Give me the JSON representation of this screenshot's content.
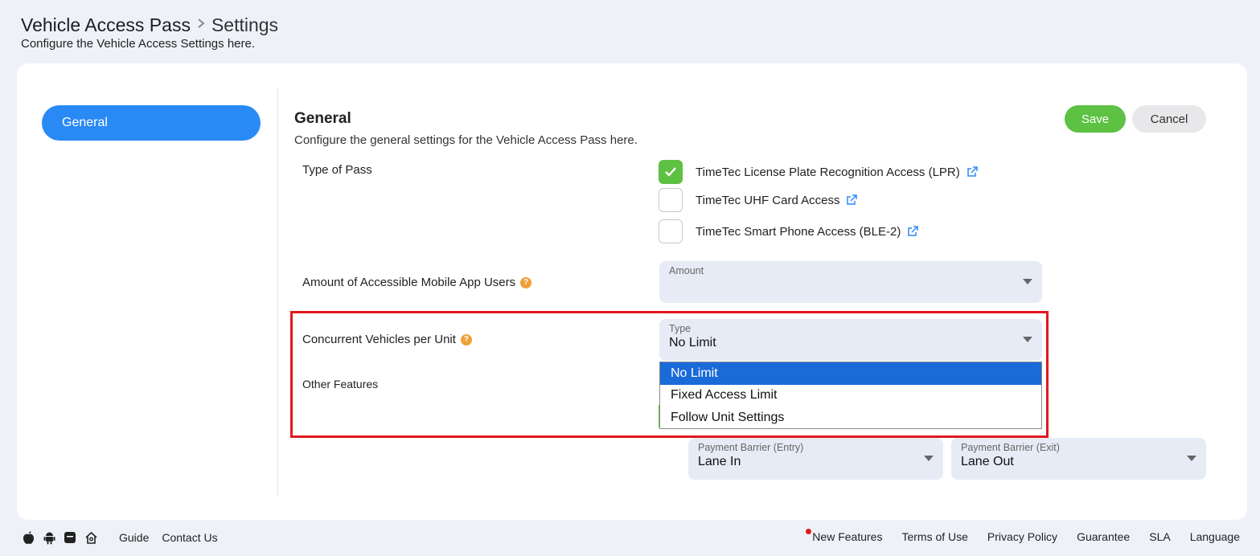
{
  "header": {
    "crumb_root": "Vehicle Access Pass",
    "crumb_current": "Settings",
    "subtitle": "Configure the Vehicle Access Settings here."
  },
  "sidebar": {
    "items": [
      {
        "label": "General",
        "active": true
      }
    ]
  },
  "section": {
    "title": "General",
    "description": "Configure the general settings for the Vehicle Access Pass here.",
    "save_label": "Save",
    "cancel_label": "Cancel"
  },
  "type_of_pass": {
    "label": "Type of Pass",
    "options": [
      {
        "label": "TimeTec License Plate Recognition Access (LPR)",
        "checked": true
      },
      {
        "label": "TimeTec UHF Card Access",
        "checked": false
      },
      {
        "label": "TimeTec Smart Phone Access (BLE-2)",
        "checked": false
      }
    ]
  },
  "mobile_users": {
    "label": "Amount of Accessible Mobile App Users",
    "field_label": "Amount",
    "value": ""
  },
  "concurrent": {
    "label": "Concurrent Vehicles per Unit",
    "field_label": "Type",
    "value": "No Limit",
    "options": [
      "No Limit",
      "Fixed Access Limit",
      "Follow Unit Settings"
    ],
    "selected_index": 0
  },
  "other_features": {
    "label": "Other Features"
  },
  "payment_barrier": {
    "entry_label": "Payment Barrier (Entry)",
    "entry_value": "Lane In",
    "exit_label": "Payment Barrier (Exit)",
    "exit_value": "Lane Out"
  },
  "footer": {
    "left_links": [
      "Guide",
      "Contact Us"
    ],
    "right_links": [
      "New Features",
      "Terms of Use",
      "Privacy Policy",
      "Guarantee",
      "SLA",
      "Language"
    ]
  },
  "colors": {
    "accent": "#2a8af5",
    "save": "#5dc143",
    "highlight": "#e0191f",
    "dropdown_selected": "#1a6ad8"
  }
}
